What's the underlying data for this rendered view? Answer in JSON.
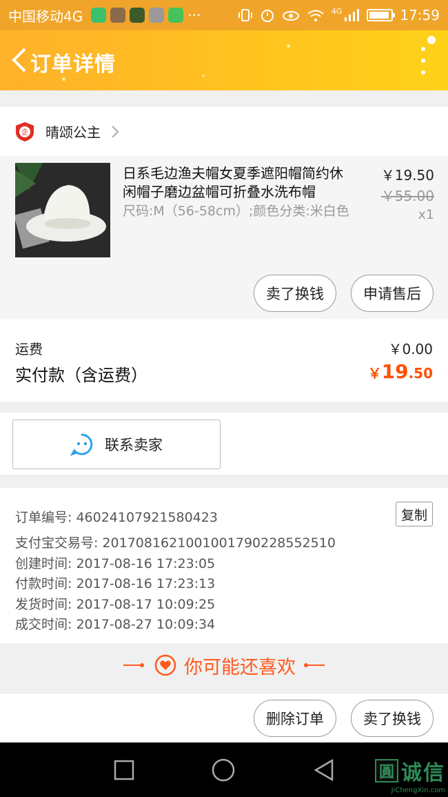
{
  "status_bar": {
    "carrier": "中国移动4G",
    "network": "4G",
    "time": "17:59",
    "dots": "···"
  },
  "nav": {
    "title": "订单详情"
  },
  "shop": {
    "name": "晴颂公主",
    "badge": "企"
  },
  "item": {
    "title": "日系毛边渔夫帽女夏季遮阳帽简约休闲帽子磨边盆帽可折叠水洗布帽",
    "spec": "尺码:M（56-58cm）;颜色分类:米白色",
    "price_now": "￥19.50",
    "price_old": "￥55.00",
    "quantity": "x1",
    "btn_sell": "卖了换钱",
    "btn_after_sale": "申请售后"
  },
  "fees": {
    "shipping_label": "运费",
    "shipping_value": "￥0.00",
    "paid_label": "实付款（含运费）",
    "paid_currency": "￥",
    "paid_int": "19",
    "paid_dec": ".50"
  },
  "contact": {
    "label": "联系卖家"
  },
  "order_info": {
    "order_no": "订单编号: 46024107921580423",
    "alipay_no": "支付宝交易号: 2017081621001001790228552510",
    "created": "创建时间: 2017-08-16 17:23:05",
    "paid": "付款时间: 2017-08-16 17:23:13",
    "shipped": "发货时间: 2017-08-17 10:09:25",
    "completed": "成交时间: 2017-08-27 10:09:34",
    "copy_label": "复制"
  },
  "recommend": {
    "text": "你可能还喜欢"
  },
  "bottom_bar": {
    "delete_label": "删除订单",
    "sell_label": "卖了换钱"
  },
  "watermark": {
    "main": "诚信",
    "box": "圓",
    "sub": "JiChengXin.com"
  },
  "colors": {
    "status_bar": "#f0a52a",
    "nav_start": "#ffb12a",
    "nav_end": "#ffd21a",
    "accent_orange": "#ff5000",
    "watermark_green": "#2e8b57"
  }
}
